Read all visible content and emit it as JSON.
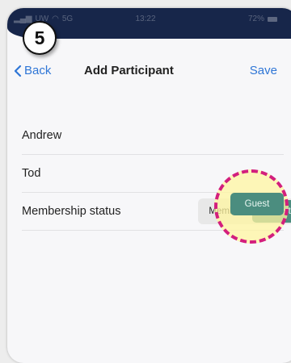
{
  "status_bar": {
    "carrier": "UW",
    "network": "5G",
    "time": "13:22",
    "battery": "72%"
  },
  "nav": {
    "back_label": "Back",
    "title": "Add Participant",
    "save_label": "Save"
  },
  "step_badge": "5",
  "form": {
    "first_name": "Andrew",
    "last_name": "Tod",
    "membership_label": "Membership status",
    "membership_options": [
      "Member",
      "Guest"
    ],
    "membership_selected": "Guest"
  },
  "colors": {
    "accent": "#2f76d6",
    "selected_segment": "#4b8d7f",
    "highlight_ring": "#d31f7d",
    "highlight_fill": "#fff6a0"
  }
}
